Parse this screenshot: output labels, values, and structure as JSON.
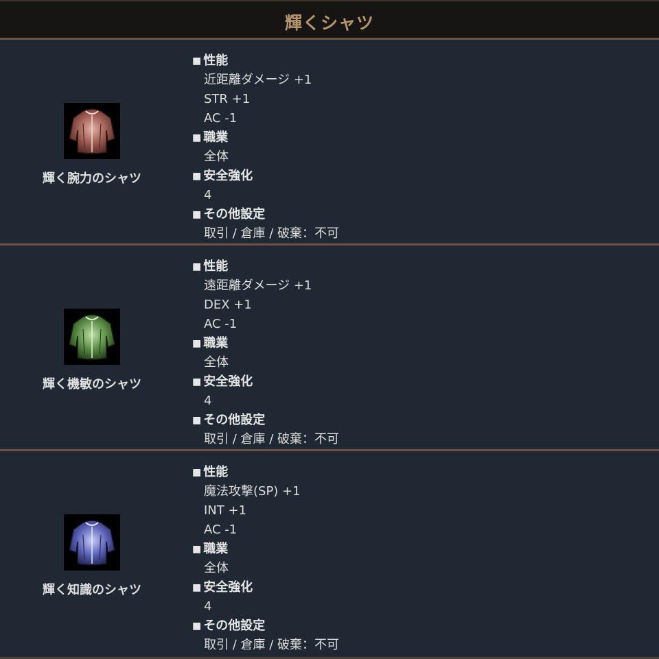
{
  "page": {
    "title": "輝くシャツ"
  },
  "labels": {
    "performance": "性能",
    "class": "職業",
    "safe_enchant": "安全強化",
    "other": "その他設定",
    "bullet": "■"
  },
  "colors": {
    "title": "#b4966a",
    "divider": "#6b5440",
    "background": "#1f2833"
  },
  "items": [
    {
      "name": "輝く腕力のシャツ",
      "icon": "red-shirt-icon",
      "icon_color": "#b86a5e",
      "performance": [
        "近距離ダメージ +1",
        "STR +1",
        "AC -1"
      ],
      "class": "全体",
      "safe_enchant": "4",
      "other": "取引 / 倉庫 / 破棄：不可"
    },
    {
      "name": "輝く機敏のシャツ",
      "icon": "green-shirt-icon",
      "icon_color": "#5f9a4a",
      "performance": [
        "遠距離ダメージ +1",
        "DEX +1",
        "AC -1"
      ],
      "class": "全体",
      "safe_enchant": "4",
      "other": "取引 / 倉庫 / 破棄：不可"
    },
    {
      "name": "輝く知識のシャツ",
      "icon": "blue-shirt-icon",
      "icon_color": "#6a72c8",
      "performance": [
        "魔法攻撃(SP) +1",
        "INT +1",
        "AC -1"
      ],
      "class": "全体",
      "safe_enchant": "4",
      "other": "取引 / 倉庫 / 破棄：不可"
    }
  ]
}
